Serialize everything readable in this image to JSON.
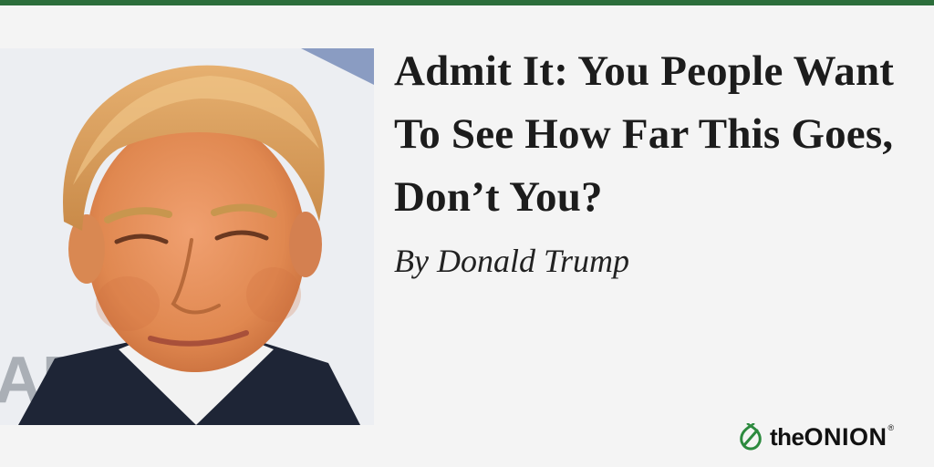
{
  "colors": {
    "accent_bar": "#2c6e3b",
    "background": "#f4f4f4",
    "logo_green": "#2c8a3e"
  },
  "article": {
    "headline": "Admit It: You People Want To See How Far This Goes, Don’t You?",
    "byline": "By Donald Trump"
  },
  "logo": {
    "prefix": "the",
    "brand": "ONION",
    "registered": "®",
    "icon": "onion-icon"
  },
  "photo": {
    "background_text": "AR"
  }
}
